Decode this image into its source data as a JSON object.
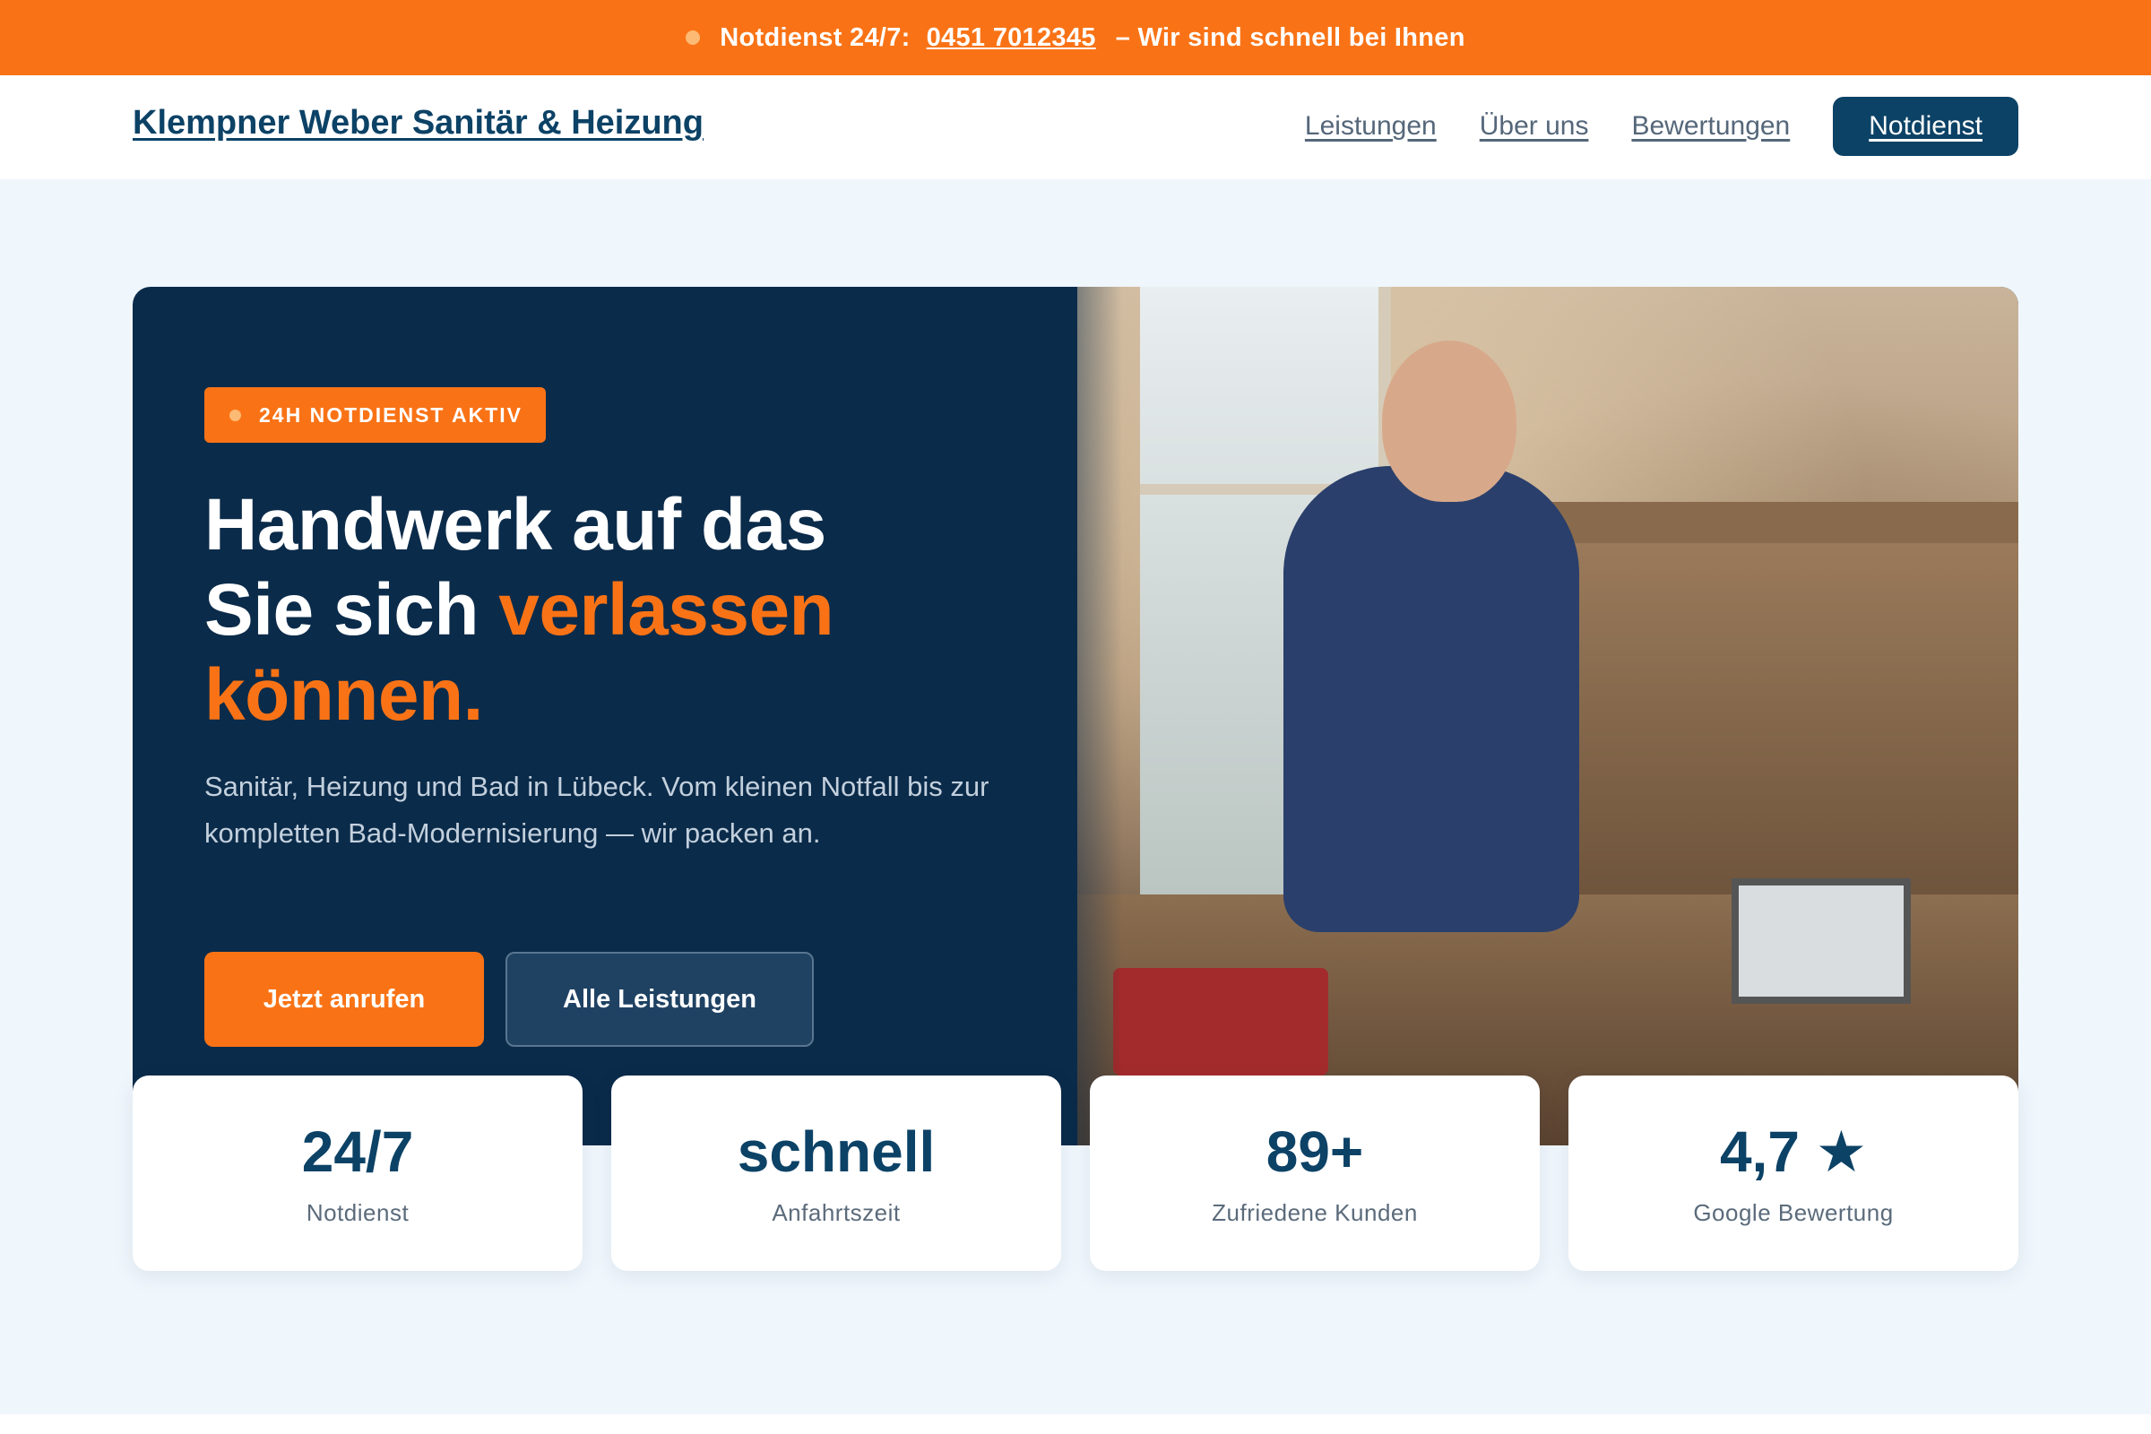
{
  "topbar": {
    "label": "Notdienst 24/7:",
    "phone": "0451 7012345",
    "tagline": "– Wir sind schnell bei Ihnen"
  },
  "header": {
    "brand": "Klempner Weber Sanitär & Heizung",
    "nav": [
      {
        "label": "Leistungen"
      },
      {
        "label": "Über uns"
      },
      {
        "label": "Bewertungen"
      }
    ],
    "cta": "Notdienst"
  },
  "hero": {
    "badge": "24H NOTDIENST AKTIV",
    "headline_line1": "Handwerk auf das",
    "headline_line2_plain": "Sie sich ",
    "headline_line2_accent": "verlassen",
    "headline_line3_accent": "können.",
    "subtitle": "Sanitär, Heizung und Bad in Lübeck. Vom kleinen Notfall bis zur kompletten Bad-Modernisierung — wir packen an.",
    "primary_button": "Jetzt anrufen",
    "secondary_button": "Alle Leistungen"
  },
  "stats": [
    {
      "value": "24/7",
      "label": "Notdienst"
    },
    {
      "value": "schnell",
      "label": "Anfahrtszeit"
    },
    {
      "value": "89+",
      "label": "Zufriedene Kunden"
    },
    {
      "value": "4,7 ★",
      "label": "Google Bewertung"
    }
  ],
  "colors": {
    "accent": "#f97316",
    "navy": "#0b2b4a",
    "brand_blue": "#0c4266",
    "background": "#eff6fc"
  }
}
